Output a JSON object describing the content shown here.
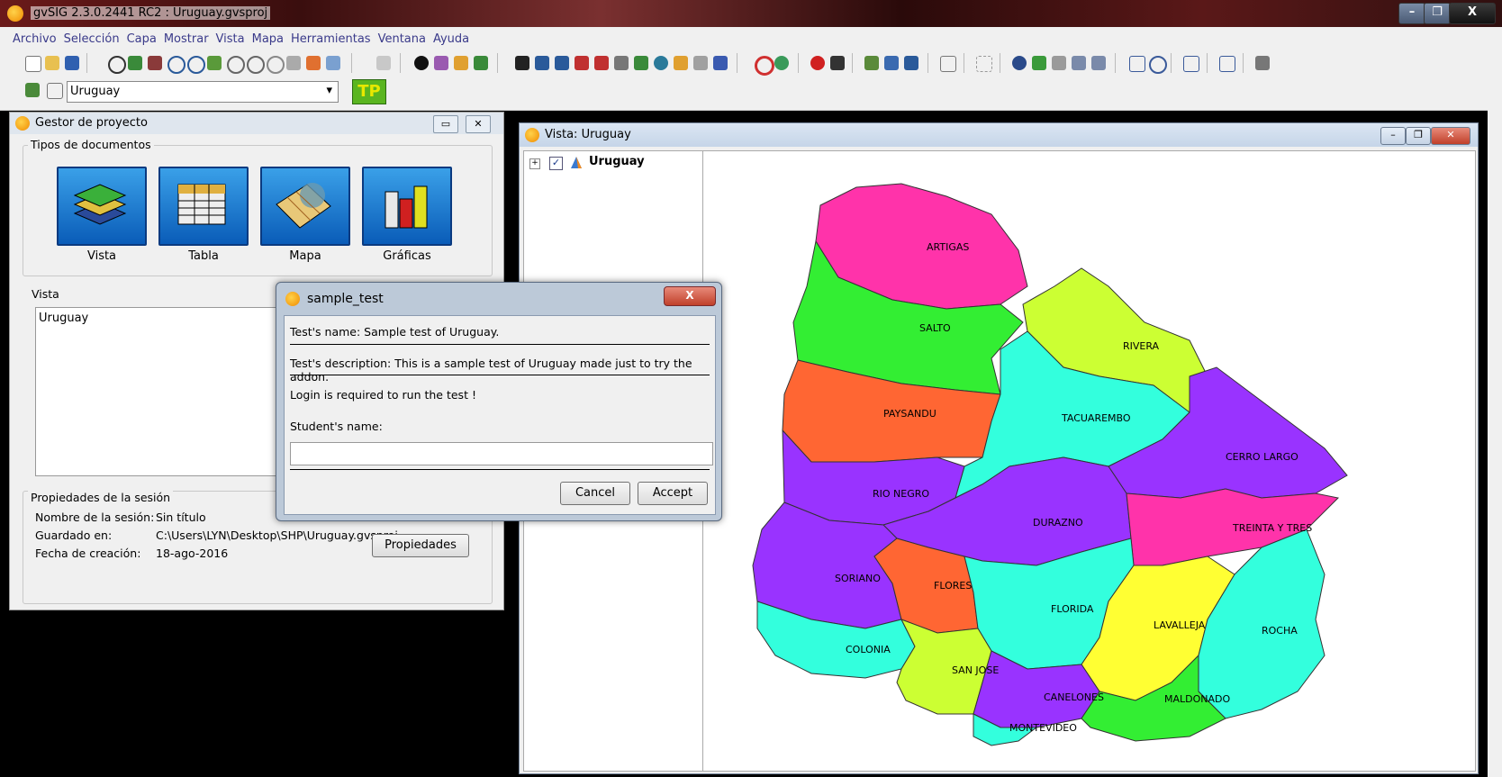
{
  "window": {
    "title": "gvSIG 2.3.0.2441 RC2 : Uruguay.gvsproj",
    "min": "–",
    "max": "❐",
    "close": "X"
  },
  "menu": [
    "Archivo",
    "Selección",
    "Capa",
    "Mostrar",
    "Vista",
    "Mapa",
    "Herramientas",
    "Ventana",
    "Ayuda"
  ],
  "toolbar": {
    "layer_combo": "Uruguay",
    "tp_button": "TP"
  },
  "project_manager": {
    "title": "Gestor de proyecto",
    "doc_types_label": "Tipos de documentos",
    "doc_types": [
      "Vista",
      "Tabla",
      "Mapa",
      "Gráficas"
    ],
    "list_label": "Vista",
    "list_items": [
      "Uruguay"
    ],
    "session_label": "Propiedades de la sesión",
    "session": {
      "name_label": "Nombre de la sesión:",
      "name_value": "Sin título",
      "saved_label": "Guardado en:",
      "saved_value": "C:\\Users\\LYN\\Desktop\\SHP\\Uruguay.gvsproj",
      "date_label": "Fecha de creación:",
      "date_value": "18-ago-2016"
    },
    "properties_button": "Propiedades"
  },
  "view_window": {
    "title": "Vista: Uruguay",
    "layer": "Uruguay",
    "layer_checked": true
  },
  "dialog": {
    "title": "sample_test",
    "close": "X",
    "test_name": "Test's name: Sample test of Uruguay.",
    "test_description": "Test's description: This is a sample test of Uruguay made just to try the addon.",
    "login_note": "Login is required to run the test !",
    "student_label": "Student's name:",
    "student_value": "",
    "cancel": "Cancel",
    "accept": "Accept"
  },
  "map": {
    "departments": [
      "ARTIGAS",
      "SALTO",
      "RIVERA",
      "PAYSANDU",
      "TACUAREMBO",
      "CERRO LARGO",
      "RIO NEGRO",
      "DURAZNO",
      "TREINTA Y TRES",
      "SORIANO",
      "FLORES",
      "FLORIDA",
      "LAVALLEJA",
      "ROCHA",
      "COLONIA",
      "SAN JOSE",
      "CANELONES",
      "MALDONADO",
      "MONTEVIDEO"
    ],
    "colors": {
      "magenta": "#ff33aa",
      "green": "#33ee33",
      "lime": "#ccff33",
      "orange": "#ff6633",
      "cyan": "#33ffdd",
      "purple": "#9933ff",
      "yellow": "#ffff33"
    }
  }
}
